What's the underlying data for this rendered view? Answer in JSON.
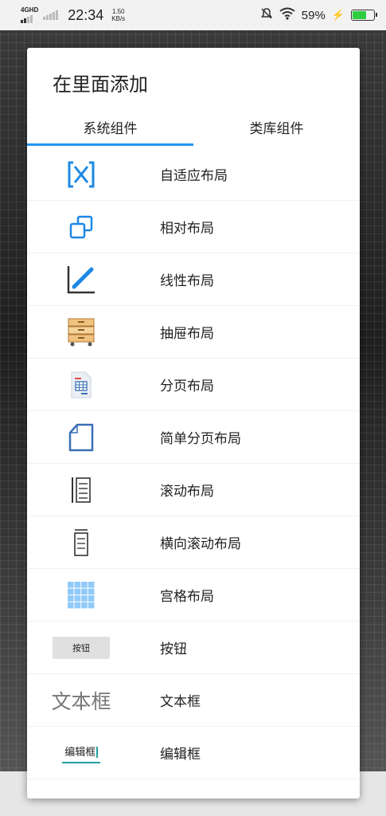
{
  "status_bar": {
    "network": "4GHD",
    "time": "22:34",
    "speed_value": "1.50",
    "speed_unit": "KB/s",
    "battery": "59%",
    "battery_level": 0.59
  },
  "dialog": {
    "title": "在里面添加",
    "tabs": [
      {
        "label": "系统组件",
        "selected": true
      },
      {
        "label": "类库组件",
        "selected": false
      }
    ],
    "items": [
      {
        "label": "自适应布局",
        "icon": "adaptive-layout-icon"
      },
      {
        "label": "相对布局",
        "icon": "relative-layout-icon"
      },
      {
        "label": "线性布局",
        "icon": "linear-layout-icon"
      },
      {
        "label": "抽屉布局",
        "icon": "drawer-layout-icon"
      },
      {
        "label": "分页布局",
        "icon": "pager-layout-icon"
      },
      {
        "label": "简单分页布局",
        "icon": "simple-pager-icon"
      },
      {
        "label": "滚动布局",
        "icon": "scroll-layout-icon"
      },
      {
        "label": "横向滚动布局",
        "icon": "horizontal-scroll-icon"
      },
      {
        "label": "宫格布局",
        "icon": "grid-layout-icon"
      },
      {
        "label": "按钮",
        "icon": "button-preview",
        "preview": "按钮"
      },
      {
        "label": "文本框",
        "icon": "textview-preview",
        "preview": "文本框"
      },
      {
        "label": "编辑框",
        "icon": "edittext-preview",
        "preview": "编辑框"
      }
    ]
  },
  "colors": {
    "accent": "#2196f3",
    "icon_blue": "#1e88e5",
    "icon_dark": "#333333"
  }
}
